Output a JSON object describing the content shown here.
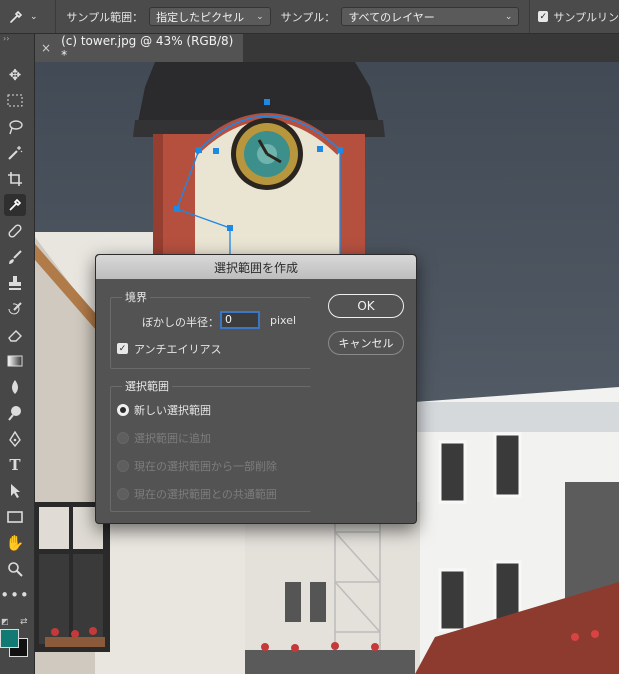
{
  "options_bar": {
    "sample_size_label": "サンプル範囲：",
    "sample_size_value": "指定したピクセル",
    "sample_label": "サンプル：",
    "sample_value": "すべてのレイヤー",
    "show_ring_label": "サンプルリン"
  },
  "document_tab": {
    "title": "(c) tower.jpg @ 43% (RGB/8) *",
    "close_glyph": "×"
  },
  "toolbar": {
    "tools": [
      "move",
      "marquee",
      "lasso",
      "magic-wand",
      "crop",
      "eyedropper",
      "healing",
      "brush",
      "stamp",
      "history-brush",
      "eraser",
      "gradient",
      "blur",
      "dodge",
      "pen",
      "type",
      "path-select",
      "rectangle",
      "hand",
      "zoom",
      "more"
    ],
    "foreground_color": "#127a74",
    "background_color": "#111111"
  },
  "dialog": {
    "title": "選択範囲を作成",
    "feather_group": "境界",
    "feather_label": "ぼかしの半径：",
    "feather_value": "0",
    "feather_unit": "pixel",
    "antialias_label": "アンチエイリアス",
    "antialias_checked": true,
    "operation_group": "選択範囲",
    "operations": [
      {
        "label": "新しい選択範囲",
        "selected": true,
        "enabled": true
      },
      {
        "label": "選択範囲に追加",
        "selected": false,
        "enabled": false
      },
      {
        "label": "現在の選択範囲から一部削除",
        "selected": false,
        "enabled": false
      },
      {
        "label": "現在の選択範囲との共通範囲",
        "selected": false,
        "enabled": false
      }
    ],
    "ok_label": "OK",
    "cancel_label": "キャンセル"
  },
  "colors": {
    "ui_panel": "#535353",
    "path_anchor": "#1e88e5",
    "accent_focus": "#3c77c6"
  }
}
